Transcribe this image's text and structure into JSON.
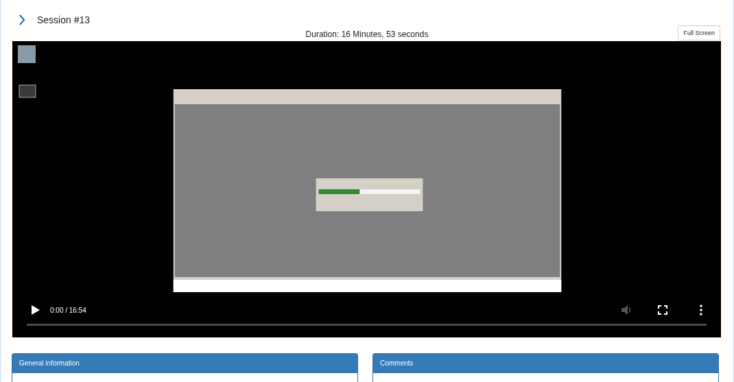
{
  "session": {
    "title": "Session #13",
    "expanded": false
  },
  "duration": "Duration: 16 Minutes, 53 seconds",
  "fullscreen_button": "Full Screen",
  "video": {
    "playing": false,
    "time": "0:00 / 16:54",
    "level": 0
  },
  "panels": [
    {
      "title": "General information"
    },
    {
      "title": "Comments"
    }
  ]
}
